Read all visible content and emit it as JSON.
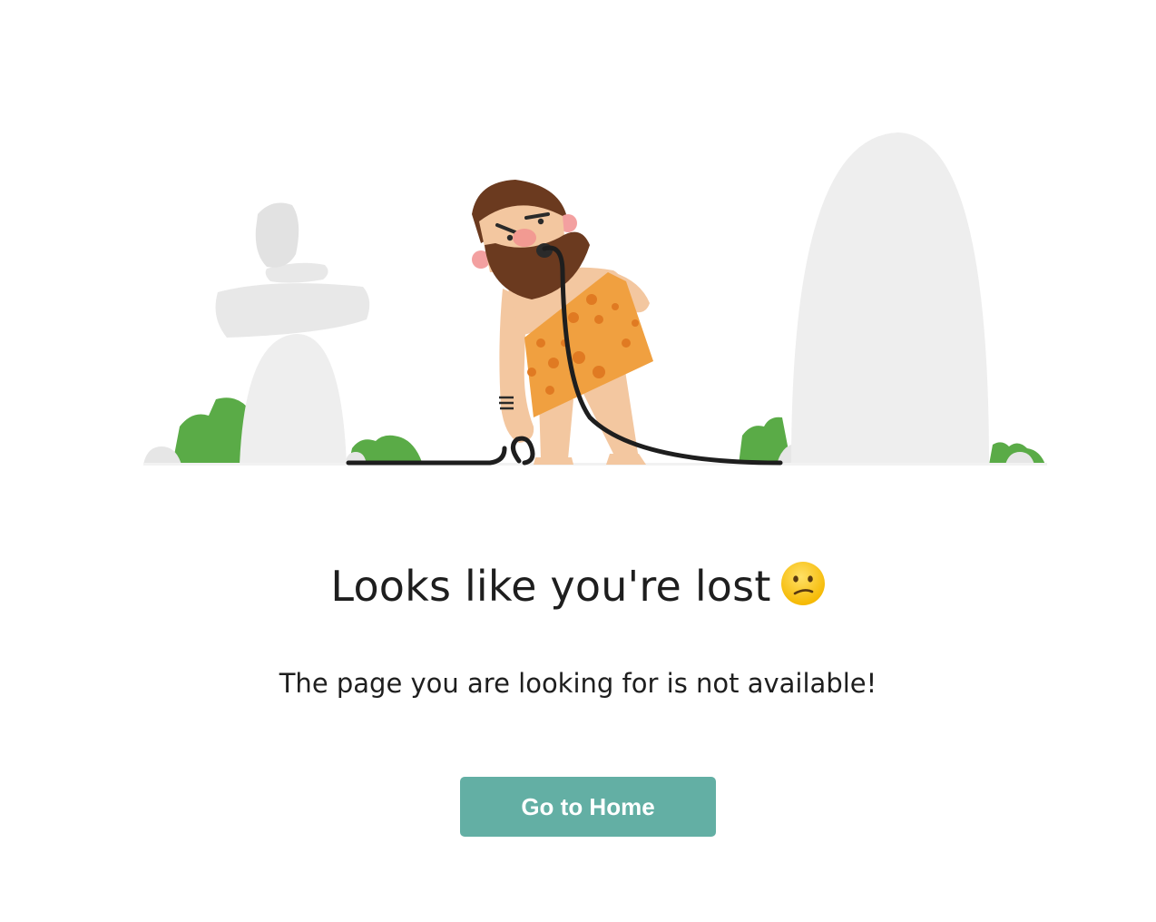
{
  "content": {
    "headline": "Looks like you're lost",
    "headline_emoji": "confused-face-emoji",
    "subtext": "The page you are looking for is not available!",
    "home_button_label": "Go to Home"
  },
  "illustration": {
    "subject": "caveman-holding-cable",
    "colors": {
      "rock": "#eeeeee",
      "bush": "#5aab47",
      "hair": "#6b3a1f",
      "skin": "#f3c7a0",
      "tunic": "#f0a040",
      "tunic_spots": "#e07a22",
      "cable": "#1e1e1e"
    }
  },
  "colors": {
    "button": "#63afa4",
    "text": "#1e1e1e",
    "background": "#ffffff"
  }
}
